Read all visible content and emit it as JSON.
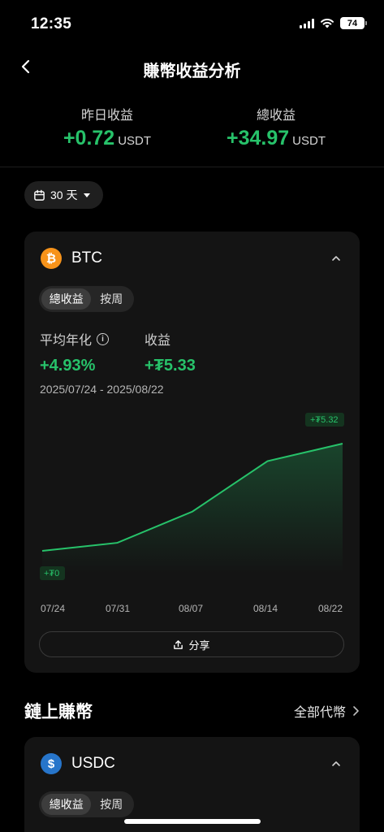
{
  "status": {
    "time": "12:35",
    "battery": "74"
  },
  "nav": {
    "title": "賺幣收益分析"
  },
  "summary": {
    "yesterday": {
      "label": "昨日收益",
      "value": "+0.72",
      "unit": "USDT"
    },
    "total": {
      "label": "總收益",
      "value": "+34.97",
      "unit": "USDT"
    }
  },
  "filter": {
    "range": "30 天"
  },
  "btc_card": {
    "coin": "BTC",
    "tabs": {
      "active": "總收益",
      "inactive": "按周"
    },
    "apy_label": "平均年化",
    "apy_value": "+4.93%",
    "profit_label": "收益",
    "profit_value": "+₮5.33",
    "date_range": "2025/07/24 - 2025/08/22",
    "share_label": "分享"
  },
  "chart_data": {
    "type": "area",
    "x": [
      "07/24",
      "07/31",
      "08/07",
      "08/14",
      "08/22"
    ],
    "y": [
      0.0,
      0.4,
      1.95,
      4.45,
      5.32
    ],
    "xticks": [
      "07/24",
      "07/31",
      "08/07",
      "08/14",
      "08/22"
    ],
    "max_label": "+₮5.32",
    "min_label": "+₮0",
    "line_color": "#27c26a",
    "grid": false
  },
  "section": {
    "title": "鏈上賺幣",
    "link": "全部代幣"
  },
  "usdc_card": {
    "coin": "USDC",
    "tabs": {
      "active": "總收益",
      "inactive": "按周"
    }
  },
  "colors": {
    "accent": "#27c26a",
    "background": "#000000",
    "card": "#141414"
  }
}
